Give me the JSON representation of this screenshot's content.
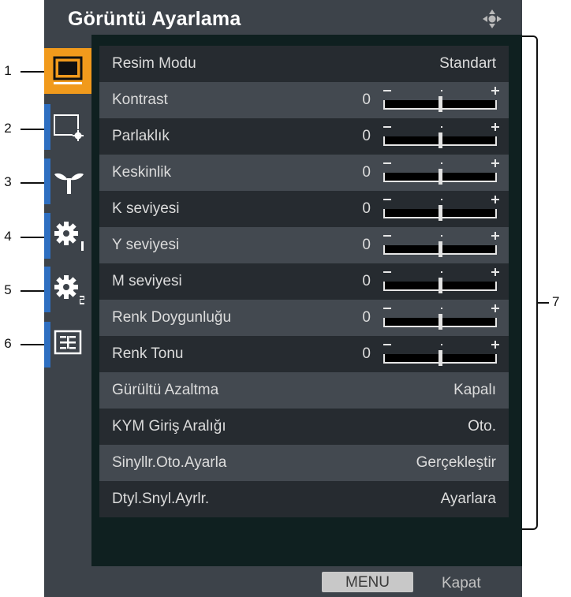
{
  "window": {
    "title": "Görüntü Ayarlama",
    "nav_icon": "four-way-navigation-icon"
  },
  "tabs": [
    {
      "icon": "monitor-icon",
      "active": true
    },
    {
      "icon": "screen-settings-icon",
      "active": false
    },
    {
      "icon": "eco-plant-icon",
      "active": false
    },
    {
      "icon": "gear-1-icon",
      "active": false
    },
    {
      "icon": "gear-2-icon",
      "active": false
    },
    {
      "icon": "info-panel-icon",
      "active": false
    }
  ],
  "callouts": [
    "1",
    "2",
    "3",
    "4",
    "5",
    "6",
    "7"
  ],
  "rows": [
    {
      "label": "Resim Modu",
      "type": "value",
      "value": "Standart"
    },
    {
      "label": "Kontrast",
      "type": "slider",
      "value": "0",
      "level": 0.5
    },
    {
      "label": "Parlaklık",
      "type": "slider",
      "value": "0",
      "level": 0.5
    },
    {
      "label": "Keskinlik",
      "type": "slider",
      "value": "0",
      "level": 0.5
    },
    {
      "label": "K seviyesi",
      "type": "slider",
      "value": "0",
      "level": 0.5
    },
    {
      "label": "Y seviyesi",
      "type": "slider",
      "value": "0",
      "level": 0.5
    },
    {
      "label": "M seviyesi",
      "type": "slider",
      "value": "0",
      "level": 0.5
    },
    {
      "label": "Renk Doygunluğu",
      "type": "slider",
      "value": "0",
      "level": 0.5
    },
    {
      "label": "Renk Tonu",
      "type": "slider",
      "value": "0",
      "level": 0.5
    },
    {
      "label": "Gürültü Azaltma",
      "type": "value",
      "value": "Kapalı"
    },
    {
      "label": "KYM Giriş Aralığı",
      "type": "value",
      "value": "Oto."
    },
    {
      "label": "Sinyllr.Oto.Ayarla",
      "type": "value",
      "value": "Gerçekleştir"
    },
    {
      "label": "Dtyl.Snyl.Ayrlr.",
      "type": "value",
      "value": "Ayarlara"
    }
  ],
  "footer": {
    "menu_label": "MENU",
    "close_label": "Kapat"
  },
  "colors": {
    "active_tab": "#f19a1c",
    "tab_strip": "#2e6fc1",
    "panel_bg": "#0f2020",
    "frame_bg": "#3d434a"
  }
}
